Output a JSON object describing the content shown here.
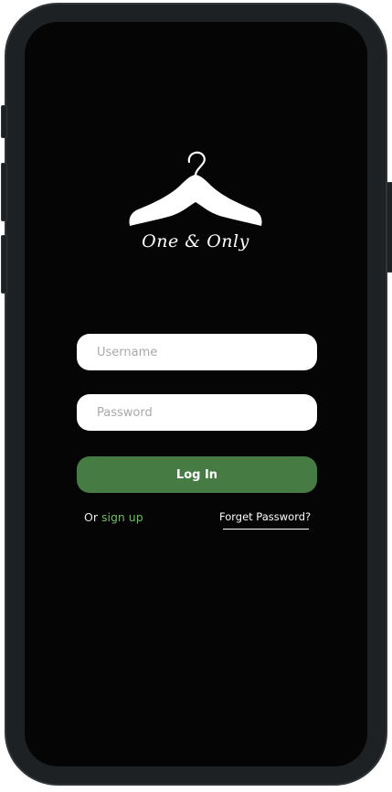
{
  "brand": {
    "logo_icon": "clothes-hanger-icon",
    "name": "One & Only"
  },
  "login_form": {
    "username_placeholder": "Username",
    "password_placeholder": "Password",
    "login_label": "Log In",
    "signup_prefix": "Or",
    "signup_label": "sign up",
    "forgot_label": "Forget Password?"
  },
  "colors": {
    "screen_bg": "#050505",
    "primary_button": "#467c44",
    "link_green": "#6fba64",
    "field_bg": "#ffffff"
  }
}
